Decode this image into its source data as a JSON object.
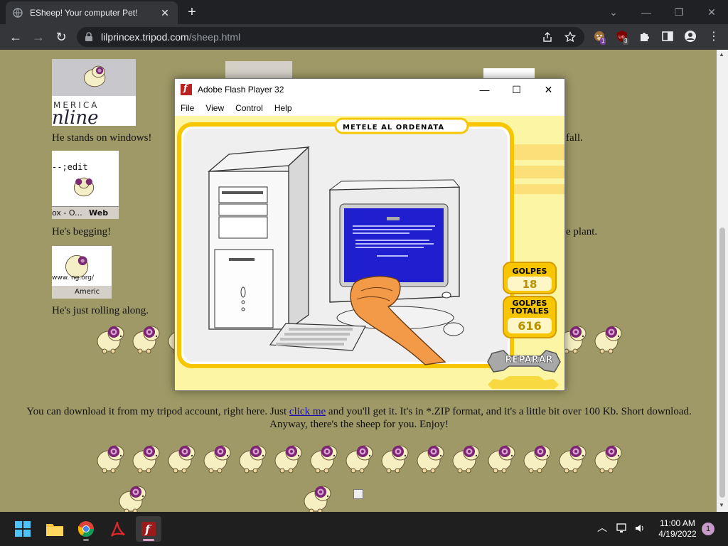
{
  "browser": {
    "tab_title": "ESheep! Your computer Pet!",
    "url_host": "lilprincex.tripod.com",
    "url_path": "/sheep.html",
    "ext_badge_1": "1",
    "ext_badge_2": "3"
  },
  "page": {
    "captions": {
      "stands": "He stands on windows!",
      "begging": "He's begging!",
      "rolling": "He's just rolling along.",
      "fall_fragment": "fall.",
      "plant_fragment": "e plant."
    },
    "thumb_texts": {
      "aol_1": "MERICA",
      "aol_2": "nline",
      "edit": "--;edit",
      "web_left": "ox - O...",
      "web_right": "Web",
      "url_frag": "www.     ng.org/",
      "americ": "Americ"
    },
    "download_before": "You can download it from my tripod account, right here. Just ",
    "download_link": "click me",
    "download_after": " and you'll get it. It's in *.ZIP format, and it's a little bit over 100 Kb. Short download. Anyway, there's the sheep for you. Enjoy!"
  },
  "flash": {
    "title": "Adobe Flash Player 32",
    "menu": [
      "File",
      "View",
      "Control",
      "Help"
    ],
    "game": {
      "banner": "METELE AL ORDENATA",
      "golpes_label": "GOLPES",
      "golpes_value": "18",
      "totales_label_1": "GOLPES",
      "totales_label_2": "TOTALES",
      "totales_value": "616",
      "reparar": "REPARAR"
    }
  },
  "taskbar": {
    "time": "11:00 AM",
    "date": "4/19/2022",
    "notifications": "1"
  }
}
